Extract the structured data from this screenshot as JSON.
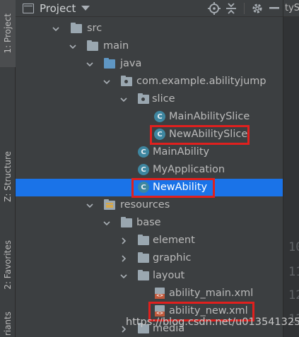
{
  "toolwindow": {
    "title": "Project",
    "left_tabs": [
      {
        "label": "1: Project"
      },
      {
        "label": "Z: Structure"
      },
      {
        "label": "2: Favorites"
      },
      {
        "label": "riants"
      }
    ]
  },
  "editor": {
    "tab_fragment": "tySl",
    "line_numbers": [
      "10",
      "11",
      "12",
      "13"
    ]
  },
  "tree": {
    "src": "src",
    "main": "main",
    "java": "java",
    "package": "com.example.abilityjump",
    "slice": "slice",
    "main_ability_slice": "MainAbilitySlice",
    "new_ability_slice": "NewAbilitySlice",
    "main_ability": "MainAbility",
    "my_application": "MyApplication",
    "new_ability": "NewAbility",
    "resources": "resources",
    "base": "base",
    "element": "element",
    "graphic": "graphic",
    "layout": "layout",
    "ability_main_xml": "ability_main.xml",
    "ability_new_xml": "ability_new.xml",
    "media": "media"
  },
  "class_badge": "C",
  "watermark": "https://blog.csdn.net/u013541325",
  "colors": {
    "selection": "#1a73e8",
    "highlight_box": "#e0201e",
    "background": "#3c3f41"
  }
}
